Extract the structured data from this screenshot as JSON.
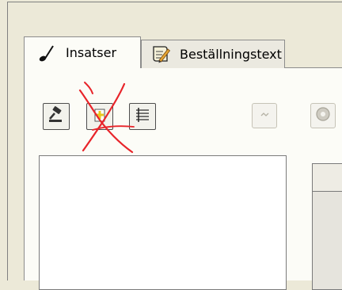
{
  "tabs": [
    {
      "label": "Insatser",
      "icon": "note-icon",
      "active": true
    },
    {
      "label": "Beställningstext",
      "icon": "pencil-document-icon",
      "active": false
    }
  ],
  "toolbar": {
    "buttons": [
      {
        "name": "gavel",
        "icon": "gavel-icon",
        "enabled": true
      },
      {
        "name": "add-item",
        "icon": "add-plus-icon",
        "enabled": true,
        "crossed_out": true
      },
      {
        "name": "list-settings",
        "icon": "list-settings-icon",
        "enabled": true
      },
      {
        "name": "disabled-action",
        "icon": "dimmed-icon",
        "enabled": false
      },
      {
        "name": "disabled-circle-action",
        "icon": "circle-icon",
        "enabled": false
      }
    ]
  },
  "annotation_color": "#e8242a"
}
